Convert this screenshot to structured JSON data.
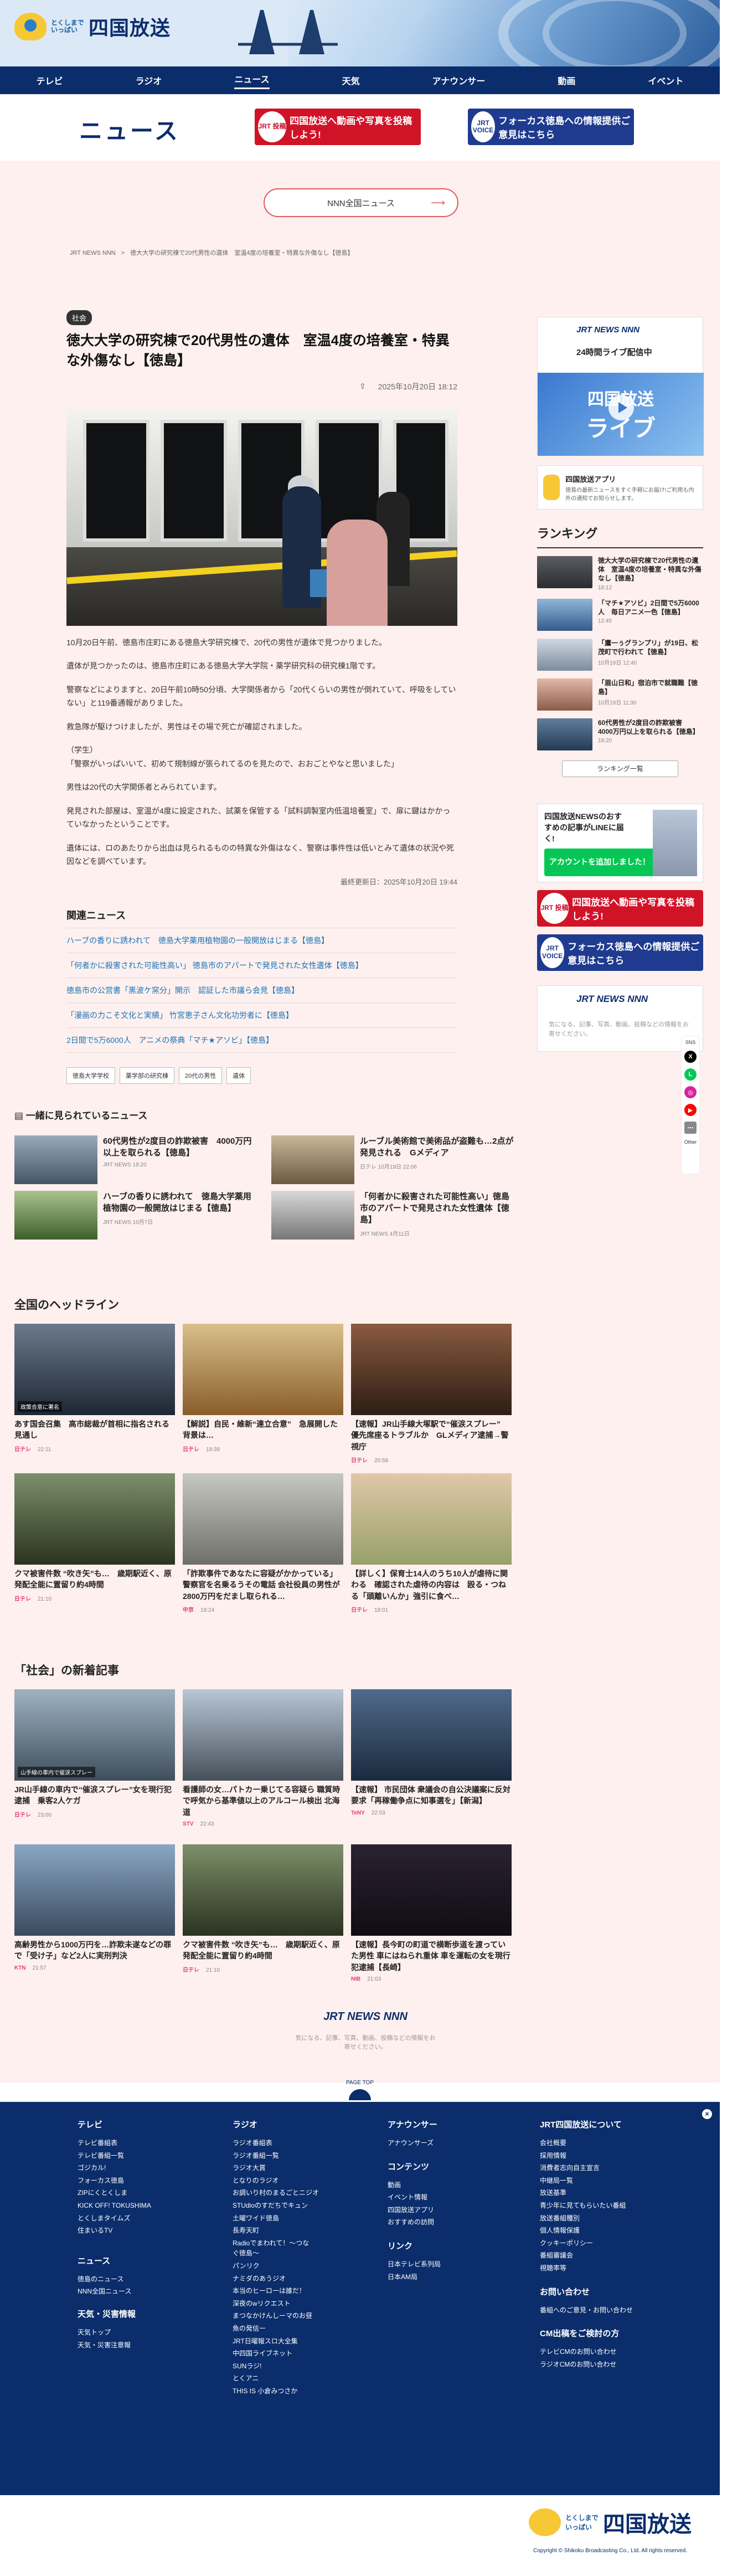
{
  "header": {
    "logo_small": "とくしまでいっぱい",
    "logo_big": "四国放送"
  },
  "nav": [
    "テレビ",
    "ラジオ",
    "ニュース",
    "天気",
    "アナウンサー",
    "動画",
    "イベント"
  ],
  "page_title": "ニュース",
  "banners": {
    "red": "四国放送へ動画や写真を投稿しよう!",
    "red_icon": "JRT 投稿",
    "blue": "フォーカス徳島への情報提供ご意見はこちら",
    "blue_icon": "JRT VOICE"
  },
  "nnn_button": "NNN全国ニュース",
  "breadcrumb": [
    "JRT NEWS NNN",
    ">",
    "徳大大学の研究棟で20代男性の遺体　室温4度の培養室・特異な外傷なし【徳島】"
  ],
  "article": {
    "category": "社会",
    "title": "徳大大学の研究棟で20代男性の遺体　室温4度の培養室・特異な外傷なし【徳島】",
    "date": "2025年10月20日 18:12",
    "paragraphs": [
      "10月20日午前、徳島市庄町にある徳島大学研究棟で、20代の男性が遺体で見つかりました。",
      "遺体が見つかったのは、徳島市庄町にある徳島大学大学院・薬学研究科の研究棟1階です。",
      "警察などによりますと、20日午前10時50分頃、大学関係者から「20代くらいの男性が倒れていて、呼吸をしていない」と119番通報がありました。",
      "救急隊が駆けつけましたが、男性はその場で死亡が確認されました。",
      "（学生）\n「警察がいっぱいいて、初めて規制線が張られてるのを見たので、おおごとやなと思いました」",
      "男性は20代の大学関係者とみられています。",
      "発見された部屋は、室温が4度に設定された、試薬を保管する「試料調製室内低温培養室」で、扉に鍵はかかっていなかったということです。",
      "遺体には、ロのあたりから出血は見られるものの特異な外傷はなく、警察は事件性は低いとみて遺体の状況や死因などを調べています。"
    ],
    "updated": "最終更新日：2025年10月20日 19:44"
  },
  "related": {
    "heading": "関連ニュース",
    "items": [
      "ハーブの香りに誘われて　徳島大学薬用植物園の一般開放はじまる【徳島】",
      "「何者かに殺害された可能性高い」 徳島市のアパートで発見された女性遺体【徳島】",
      "徳島市の公営書「黒波ケ窯分」開示　認証した市議ら会見【徳島】",
      "「漫画の力こそ文化と実績」 竹宮恵子さん文化功労者に【徳島】",
      "2日間で5万6000人　アニメの祭典「マチ★アソビ」【徳島】"
    ]
  },
  "tags": [
    "徳島大学学校",
    "薬学部の研究棟",
    "20代の男性",
    "遺体"
  ],
  "sidebar": {
    "live_logo": "JRT NEWS NNN",
    "live_text": "24時間ライブ配信中",
    "live_img_a": "四国放送",
    "live_img_b": "ライブ",
    "app_title": "四国放送アプリ",
    "app_text": "徳島の最新ニュースをすぐ手軽にお届け!ご利用も内外の通知でお知らせします。",
    "ranking_title": "ランキング",
    "ranking": [
      {
        "title": "徳大大学の研究棟で20代男性の遺体　室温4度の培養室・特異な外傷なし【徳島】",
        "date": "18:12"
      },
      {
        "title": "「マチ★アソビ」2日間で5万6000人　毎日アニメ一色【徳島】",
        "date": "12:45"
      },
      {
        "title": "「鷹一ぅグランプリ」が19日、松茂町で行われて【徳島】",
        "date": "10月19日 12:40"
      },
      {
        "title": "「眉山日和」宿泊市で就職難【徳島】",
        "date": "10月19日 11:30"
      },
      {
        "title": "60代男性が2度目の詐欺被害　4000万円以上を取られる【徳島】",
        "date": "18:20"
      }
    ],
    "ranking_btn": "ランキング一覧",
    "line_title": "四国放送NEWSのおすすめの記事がLINEに届く!",
    "line_btn": "アカウントを追加しました！",
    "jrt_logo": "JRT NEWS NNN",
    "jrt_text": "気になる、記事、写真、動画、投稿などの情報をお寄せください。"
  },
  "sns": {
    "label": "SNS",
    "items": [
      "X",
      "LINE",
      "Instagram",
      "YouTube",
      "Other"
    ]
  },
  "also_viewed": {
    "heading": "一緒に見られているニュース",
    "items": [
      {
        "title": "60代男性が2度目の詐欺被害　4000万円以上を取られる【徳島】",
        "src": "JRT NEWS",
        "date": "18:20"
      },
      {
        "title": "ルーブル美術館で美術品が盗難も…2点が発見される　Gメディア",
        "src": "日テレ",
        "date": "10月19日 22:06"
      },
      {
        "title": "ハーブの香りに誘われて　徳島大学薬用植物園の一般開放はじまる【徳島】",
        "src": "JRT NEWS",
        "date": "10月7日"
      },
      {
        "title": "「何者かに殺害された可能性高い」徳島市のアパートで発見された女性遺体【徳島】",
        "src": "JRT NEWS",
        "date": "4月11日"
      }
    ]
  },
  "headline": {
    "heading": "全国のヘッドライン",
    "cards": [
      {
        "title": "あす国会召集　高市総裁が首相に指名される見通し",
        "src": "日テレ",
        "date": "22:11",
        "cap": "政策合意に署名"
      },
      {
        "title": "【解説】自民・維新“連立合意”　急展開した背景は…",
        "src": "日テレ",
        "date": "19:39",
        "cap": ""
      },
      {
        "title": "【速報】JR山手線大塚駅で“催涙スプレー”　優先席座るトラブルか　GLメディア逮捕→警視庁",
        "src": "日テレ",
        "date": "20:58",
        "cap": ""
      },
      {
        "title": "クマ被害件数 “吹き矢”も…　歳期駅近く、原発配全能に置留り約4時間",
        "src": "日テレ",
        "date": "21:10",
        "cap": ""
      },
      {
        "title": "「詐欺事件であなたに容疑がかかっている」警察官を名乗るうその電話 会社役員の男性が2800万円をだまし取られる…",
        "src": "中京",
        "date": "19:24",
        "cap": ""
      },
      {
        "title": "【詳しく】保育士14人のうち10人が虐待に関わる　確認された虐待の内容は　殴る・つねる「頭離いんか」強引に食べ…",
        "src": "日テレ",
        "date": "18:01",
        "cap": ""
      }
    ]
  },
  "latest": {
    "heading": "「社会」の新着記事",
    "cards": [
      {
        "title": "JR山手線の車内で“催涙スプレー”女を現行犯逮捕　乗客2人ケガ",
        "src": "日テレ",
        "date": "23:00",
        "cap": "山手線の車内で催涙スプレー"
      },
      {
        "title": "看護師の女…パトカー乗じてる容疑ら 職質時で呼気から基準値以上のアルコール検出 北海道",
        "src": "STV",
        "date": "22:43",
        "cap": ""
      },
      {
        "title": "【速報】 市民団体 衆議会の自公決議案に反対要求「再稼働争点に知事選を」【新潟】",
        "src": "TeNY",
        "date": "22:03",
        "cap": ""
      },
      {
        "title": "高齢男性から1000万円を…詐欺未遂などの罪で「受け子」など2人に実刑判決",
        "src": "KTN",
        "date": "21:57",
        "cap": ""
      },
      {
        "title": "クマ被害件数 “吹き矢”も…　歳期駅近く、原発配全能に置留り約4時間",
        "src": "日テレ",
        "date": "21:10",
        "cap": ""
      },
      {
        "title": "【速報】長今町の町道で横断歩道を渡っていた男性 車にはねられ重体 車を運転の女を現行犯逮捕【長崎】",
        "src": "NIB",
        "date": "21:03",
        "cap": ""
      }
    ]
  },
  "bottom_ad": {
    "logo": "JRT NEWS NNN",
    "text": "気になる、記事、写真、動画、投稿などの情報をお寄せください。"
  },
  "page_top": "PAGE TOP",
  "footer": {
    "tv": {
      "h": "テレビ",
      "items": [
        "テレビ番組表",
        "テレビ番組一覧",
        "ゴジカル!",
        "フォーカス徳島",
        "ZIPにくとくしま",
        "KICK OFF! TOKUSHIMA",
        "とくしまタイムズ",
        "住まいるTV"
      ]
    },
    "news": {
      "h": "ニュース",
      "items": [
        "徳島のニュース",
        "NNN全国ニュース"
      ]
    },
    "weather": {
      "h": "天気・災害情報",
      "items": [
        "天気トップ",
        "天気・災害注意報"
      ]
    },
    "radio": {
      "h": "ラジオ",
      "items": [
        "ラジオ番組表",
        "ラジオ番組一覧",
        "ラジオ大賞",
        "となりのラジオ",
        "お調いり村のまるごとニジオ",
        "STUdioのすだちでキュン",
        "土曜ワイド徳島",
        "長寿天町",
        "Radioでまわれて！〜つなぐ徳島〜",
        "パンリク",
        "ナミダのあうジオ",
        "本当のヒーローは誰だ！",
        "深夜のwリクエスト",
        "まつなかけんしーマのお昼",
        "魚の発信ー",
        "JRT日曜報スロ大全集",
        "中四国ライブネット",
        "SUNラジ!",
        "とくアニ",
        "THIS IS 小倉みつさか"
      ]
    },
    "ann": {
      "h": "アナウンサー",
      "items": [
        "アナウンサーズ"
      ]
    },
    "content": {
      "h": "コンテンツ",
      "items": [
        "動画",
        "イベント情報",
        "四国放送アプリ",
        "おすすめの訪問"
      ]
    },
    "link": {
      "h": "リンク",
      "items": [
        "日本テレビ系列局",
        "日本AM局"
      ]
    },
    "about": {
      "h": "JRT四国放送について",
      "items": [
        "会社概要",
        "採用情報",
        "消費者志向自主宣言",
        "中継局一覧",
        "放送基準",
        "青少年に見てもらいたい番組",
        "放送番組種別",
        "個人情報保護",
        "クッキーポリシー",
        "番組審議会",
        "視聴率等"
      ]
    },
    "contact": {
      "h": "お問い合わせ",
      "items": [
        "番組へのご意見・お問い合わせ"
      ]
    },
    "cm": {
      "h": "CM出稿をご検討の方",
      "items": [
        "テレビCMのお問い合わせ",
        "ラジオCMのお問い合わせ"
      ]
    }
  },
  "copyright": "Copyright © Shikoku Broadcasting Co., Ltd. All rights reserved."
}
